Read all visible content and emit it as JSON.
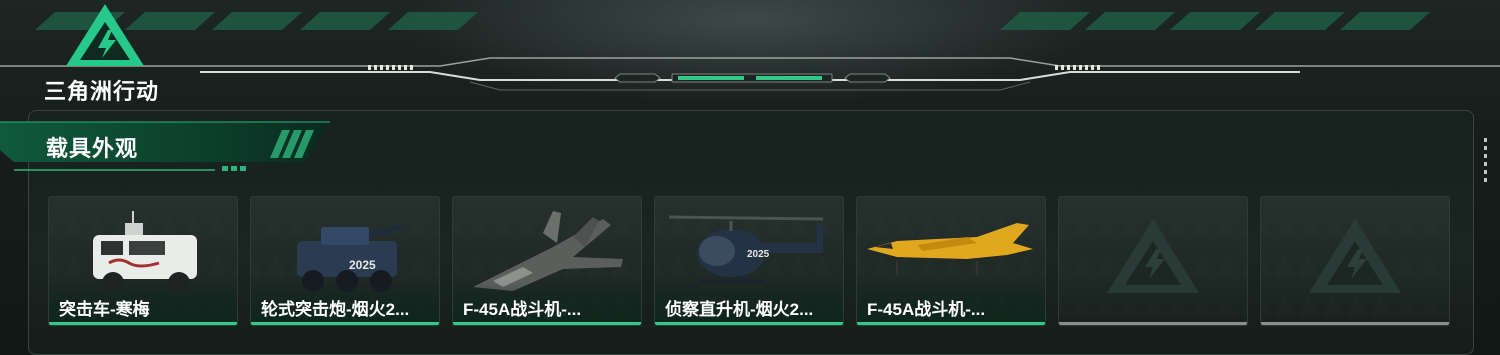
{
  "game": {
    "logo_text": "三角洲行动"
  },
  "section": {
    "title": "载具外观"
  },
  "cards": [
    {
      "label": "突击车-寒梅",
      "vehicle": "assault-vehicle-icon",
      "state": "owned"
    },
    {
      "label": "轮式突击炮-烟火2...",
      "vehicle": "wheeled-assault-gun-icon",
      "state": "owned"
    },
    {
      "label": "F-45A战斗机-...",
      "vehicle": "fighter-jet-icon",
      "state": "owned"
    },
    {
      "label": "侦察直升机-烟火2...",
      "vehicle": "scout-helicopter-icon",
      "state": "owned"
    },
    {
      "label": "F-45A战斗机-...",
      "vehicle": "fighter-jet-yellow-icon",
      "state": "owned"
    },
    {
      "label": "",
      "vehicle": "placeholder-logo-icon",
      "state": "empty"
    },
    {
      "label": "",
      "vehicle": "placeholder-logo-icon",
      "state": "empty"
    }
  ],
  "colors": {
    "accent": "#33c98a",
    "accent_dark": "#0f6b45",
    "empty_line": "#8a8f8d"
  }
}
